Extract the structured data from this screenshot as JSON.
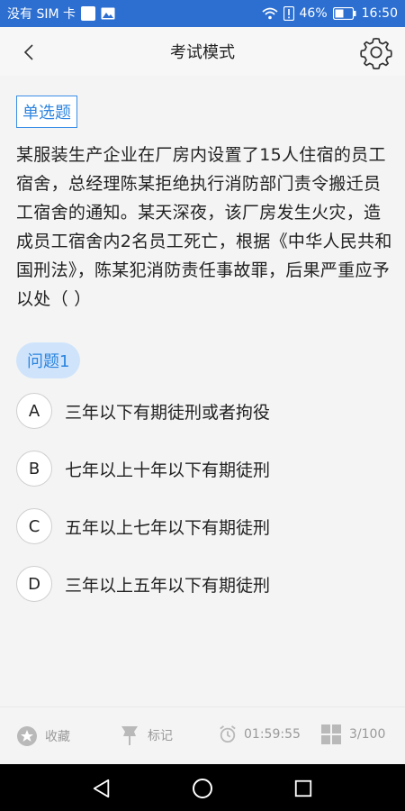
{
  "status_bar": {
    "carrier": "没有 SIM 卡",
    "battery_percent": "46%",
    "time": "16:50"
  },
  "header": {
    "title": "考试模式"
  },
  "question": {
    "type_label": "单选题",
    "text": "某服装生产企业在厂房内设置了15人住宿的员工宿舍，总经理陈某拒绝执行消防部门责令搬迁员工宿舍的通知。某天深夜，该厂房发生火灾，造成员工宿舍内2名员工死亡，根据《中华人民共和国刑法》，陈某犯消防责任事故罪，后果严重应予以处（ ）",
    "badge": "问题1",
    "options": [
      {
        "letter": "A",
        "text": "三年以下有期徒刑或者拘役"
      },
      {
        "letter": "B",
        "text": "七年以上十年以下有期徒刑"
      },
      {
        "letter": "C",
        "text": "五年以上七年以下有期徒刑"
      },
      {
        "letter": "D",
        "text": "三年以上五年以下有期徒刑"
      }
    ]
  },
  "toolbar": {
    "favorite_label": "收藏",
    "mark_label": "标记",
    "timer": "01:59:55",
    "progress": "3/100"
  },
  "colors": {
    "status_bar": "#2c6fd1",
    "accent": "#2f86e0",
    "badge_bg": "#cfe4fb"
  }
}
